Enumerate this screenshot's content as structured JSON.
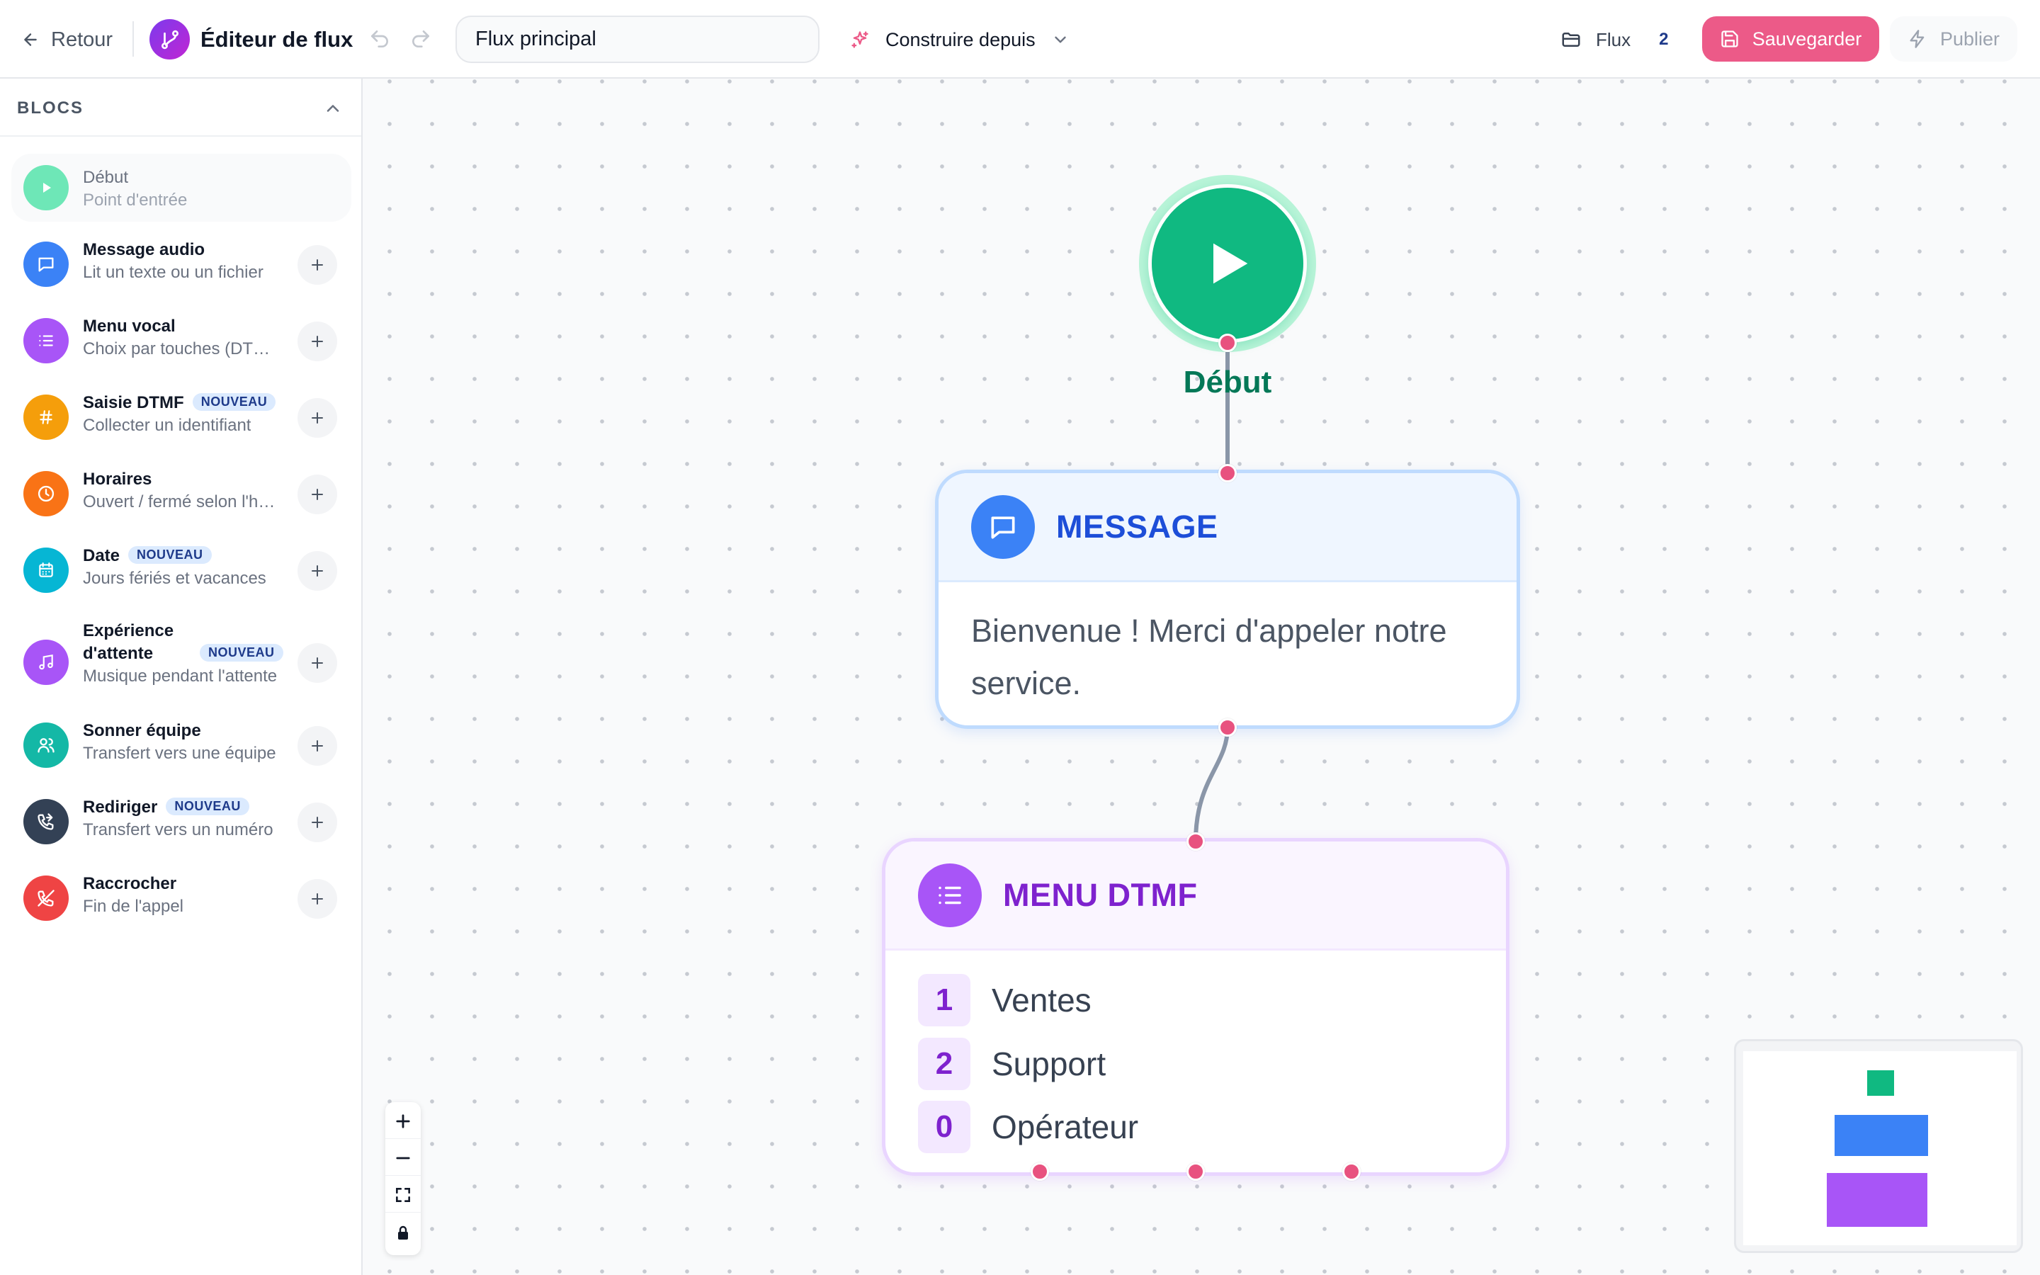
{
  "header": {
    "back_label": "Retour",
    "app_title": "Éditeur de flux",
    "flow_name": "Flux principal",
    "build_label": "Construire depuis",
    "flux_label": "Flux",
    "flux_count": "2",
    "save_label": "Sauvegarder",
    "publish_label": "Publier"
  },
  "sidebar": {
    "title": "BLOCS",
    "items": [
      {
        "name": "Début",
        "desc": "Point d'entrée",
        "icon": "play-icon",
        "color": "#6ee7b7"
      },
      {
        "name": "Message audio",
        "desc": "Lit un texte ou un fichier",
        "icon": "message-icon",
        "color": "#3b82f6"
      },
      {
        "name": "Menu vocal",
        "desc": "Choix par touches (DTMF)",
        "icon": "list-icon",
        "color": "#a855f7"
      },
      {
        "name": "Saisie DTMF",
        "badge": "NOUVEAU",
        "desc": "Collecter un identifiant",
        "icon": "hash-icon",
        "color": "#f59e0b"
      },
      {
        "name": "Horaires",
        "desc": "Ouvert / fermé selon l'horaire",
        "icon": "clock-icon",
        "color": "#f97316"
      },
      {
        "name": "Date",
        "badge": "NOUVEAU",
        "desc": "Jours fériés et vacances",
        "icon": "calendar-icon",
        "color": "#06b6d4"
      },
      {
        "name": "Expérience",
        "name2": "d'attente",
        "badge": "NOUVEAU",
        "desc": "Musique pendant l'attente",
        "icon": "music-icon",
        "color": "#a855f7"
      },
      {
        "name": "Sonner équipe",
        "desc": "Transfert vers une équipe",
        "icon": "users-icon",
        "color": "#14b8a6"
      },
      {
        "name": "Rediriger",
        "badge": "NOUVEAU",
        "desc": "Transfert vers un numéro",
        "icon": "phone-forward-icon",
        "color": "#334155"
      },
      {
        "name": "Raccrocher",
        "desc": "Fin de l'appel",
        "icon": "phone-off-icon",
        "color": "#ef4444"
      }
    ]
  },
  "canvas": {
    "start_label": "Début",
    "message_node": {
      "title": "MESSAGE",
      "text": "Bienvenue ! Merci d'appeler notre service."
    },
    "menu_node": {
      "title": "MENU DTMF",
      "options": [
        {
          "key": "1",
          "label": "Ventes"
        },
        {
          "key": "2",
          "label": "Support"
        },
        {
          "key": "0",
          "label": "Opérateur"
        }
      ]
    }
  },
  "colors": {
    "accent": "#ec5a88",
    "start": "#10b981",
    "message": "#3b82f6",
    "menu": "#a855f7"
  }
}
